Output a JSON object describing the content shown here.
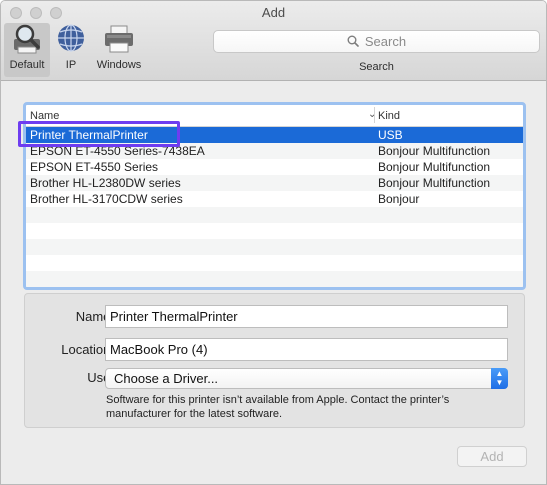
{
  "window": {
    "title": "Add"
  },
  "toolbar": {
    "default_label": "Default",
    "ip_label": "IP",
    "windows_label": "Windows",
    "search_placeholder": "Search",
    "search_caption": "Search"
  },
  "printer_list": {
    "columns": {
      "name": "Name",
      "kind": "Kind"
    },
    "rows": [
      {
        "name": "Printer ThermalPrinter",
        "kind": "USB",
        "selected": true
      },
      {
        "name": "EPSON ET-4550 Series-7438EA",
        "kind": "Bonjour Multifunction",
        "selected": false
      },
      {
        "name": "EPSON ET-4550 Series",
        "kind": "Bonjour Multifunction",
        "selected": false
      },
      {
        "name": "Brother HL-L2380DW series",
        "kind": "Bonjour Multifunction",
        "selected": false
      },
      {
        "name": "Brother HL-3170CDW series",
        "kind": "Bonjour",
        "selected": false
      }
    ]
  },
  "details": {
    "name_label": "Name:",
    "name_value": "Printer ThermalPrinter",
    "location_label": "Location:",
    "location_value": "MacBook Pro (4)",
    "use_label": "Use:",
    "use_value": "Choose a Driver...",
    "note": "Software for this printer isn’t available from Apple. Contact the printer’s manufacturer for the latest software."
  },
  "buttons": {
    "add": "Add"
  },
  "colors": {
    "selection": "#1b6ad7",
    "list_focus_ring": "#9cc1f0",
    "highlight_box": "#6e3df0"
  },
  "icons": {
    "default": "magnifier-printer-icon",
    "ip": "globe-icon",
    "windows": "printer-icon",
    "search": "search-icon",
    "sort": "chevron-down-icon",
    "popup": "popup-arrows-icon"
  }
}
